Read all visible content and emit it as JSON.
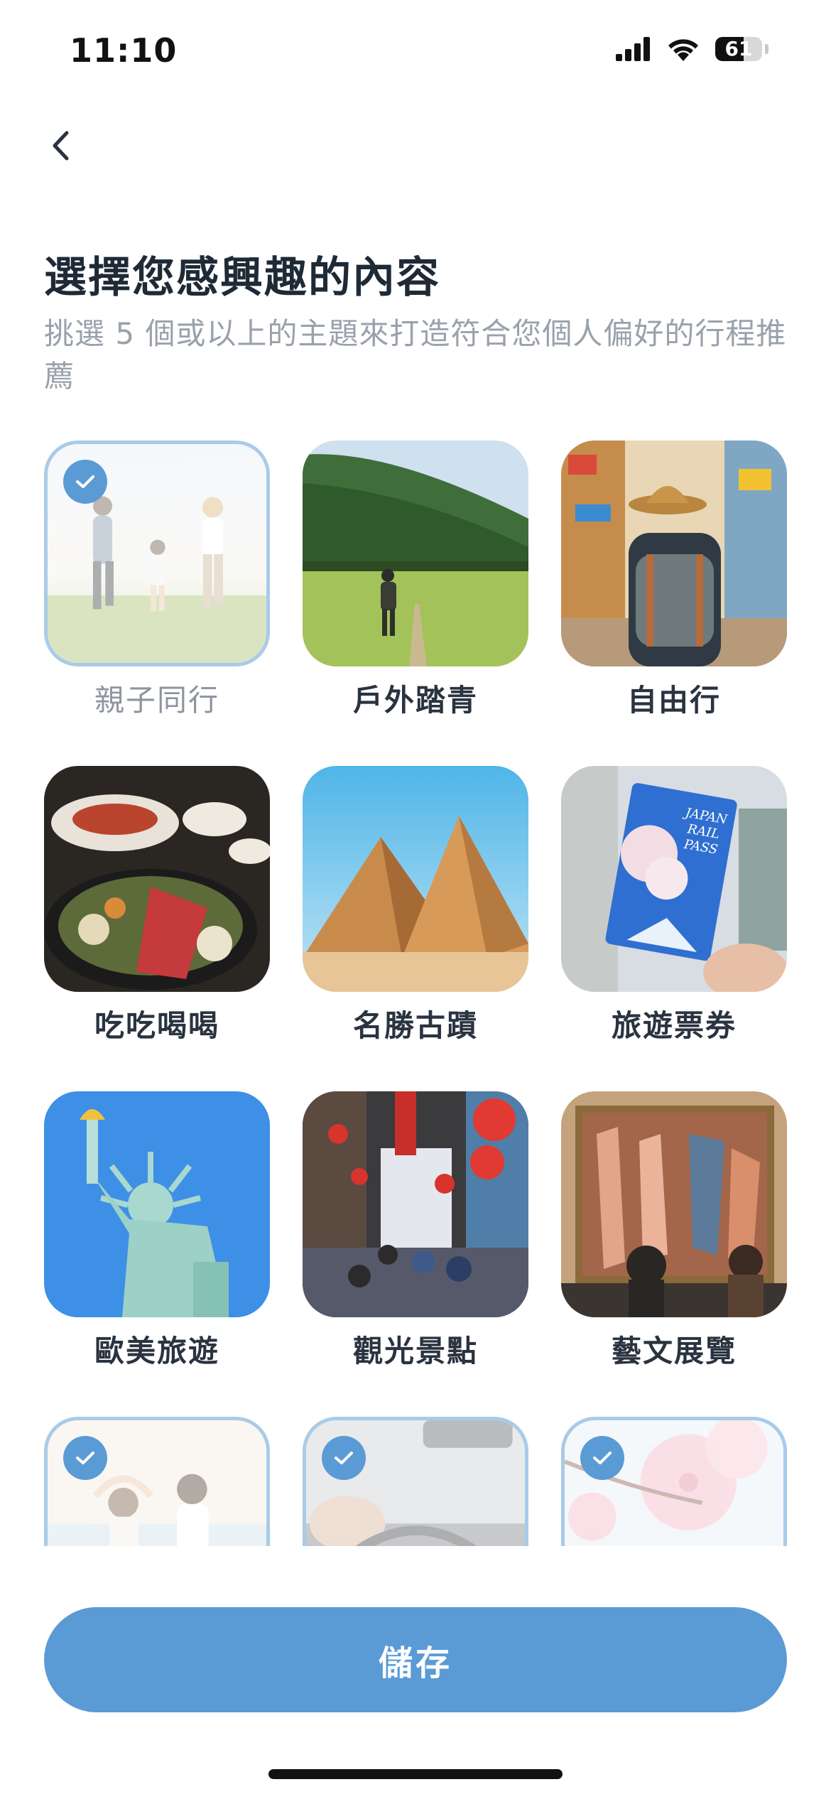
{
  "status_bar": {
    "time": "11:10",
    "battery_level": "61",
    "icons": [
      "signal-icon",
      "wifi-icon",
      "battery-icon"
    ]
  },
  "navigation": {
    "back_icon": "chevron-left-icon"
  },
  "header": {
    "title": "選擇您感興趣的內容",
    "subtitle": "挑選 5 個或以上的主題來打造符合您個人偏好的行程推薦"
  },
  "topics": [
    {
      "label": "親子同行",
      "selected": true
    },
    {
      "label": "戶外踏青",
      "selected": false
    },
    {
      "label": "自由行",
      "selected": false
    },
    {
      "label": "吃吃喝喝",
      "selected": false
    },
    {
      "label": "名勝古蹟",
      "selected": false
    },
    {
      "label": "旅遊票券",
      "selected": false
    },
    {
      "label": "歐美旅遊",
      "selected": false
    },
    {
      "label": "觀光景點",
      "selected": false
    },
    {
      "label": "藝文展覽",
      "selected": false
    },
    {
      "label": "",
      "selected": true
    },
    {
      "label": "",
      "selected": true
    },
    {
      "label": "",
      "selected": true
    }
  ],
  "ticket_art": {
    "line1": "JAPAN",
    "line2": "RAIL",
    "line3": "PASS"
  },
  "save_button": {
    "label": "儲存"
  },
  "colors": {
    "accent": "#5b9bd5",
    "selected_border": "#a9cbe8",
    "title": "#1f2a37",
    "subtitle": "#9aa1ab"
  }
}
